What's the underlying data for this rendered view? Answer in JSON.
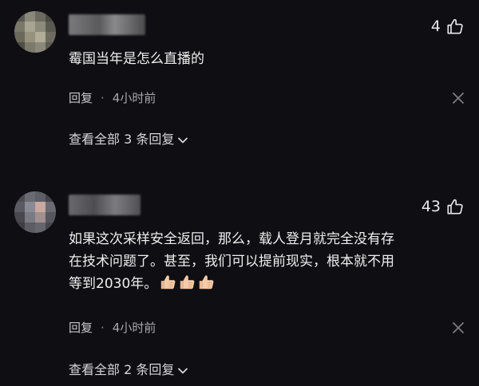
{
  "comments": [
    {
      "likes": "4",
      "text": "霉国当年是怎么直播的",
      "reply_label": "回复",
      "separator": "·",
      "time": "4小时前",
      "view_replies": "查看全部 3 条回复"
    },
    {
      "likes": "43",
      "text_line1": "如果这次采样安全返回，那么，载人登月就完全没有存",
      "text_line2": "在技术问题了。甚至，我们可以提前现实，根本就不用",
      "text_line3": "等到2030年。",
      "reply_label": "回复",
      "separator": "·",
      "time": "4小时前",
      "view_replies": "查看全部 2 条回复"
    }
  ],
  "icons": {
    "like": "thumbs-up-icon",
    "close": "close-icon",
    "chevron": "chevron-down-icon",
    "emoji": "thumbs-up-emoji"
  },
  "colors": {
    "background": "#0f0f13",
    "text": "#eeeeef",
    "muted": "#a8a8ac",
    "emoji": "#f1c9a5"
  }
}
